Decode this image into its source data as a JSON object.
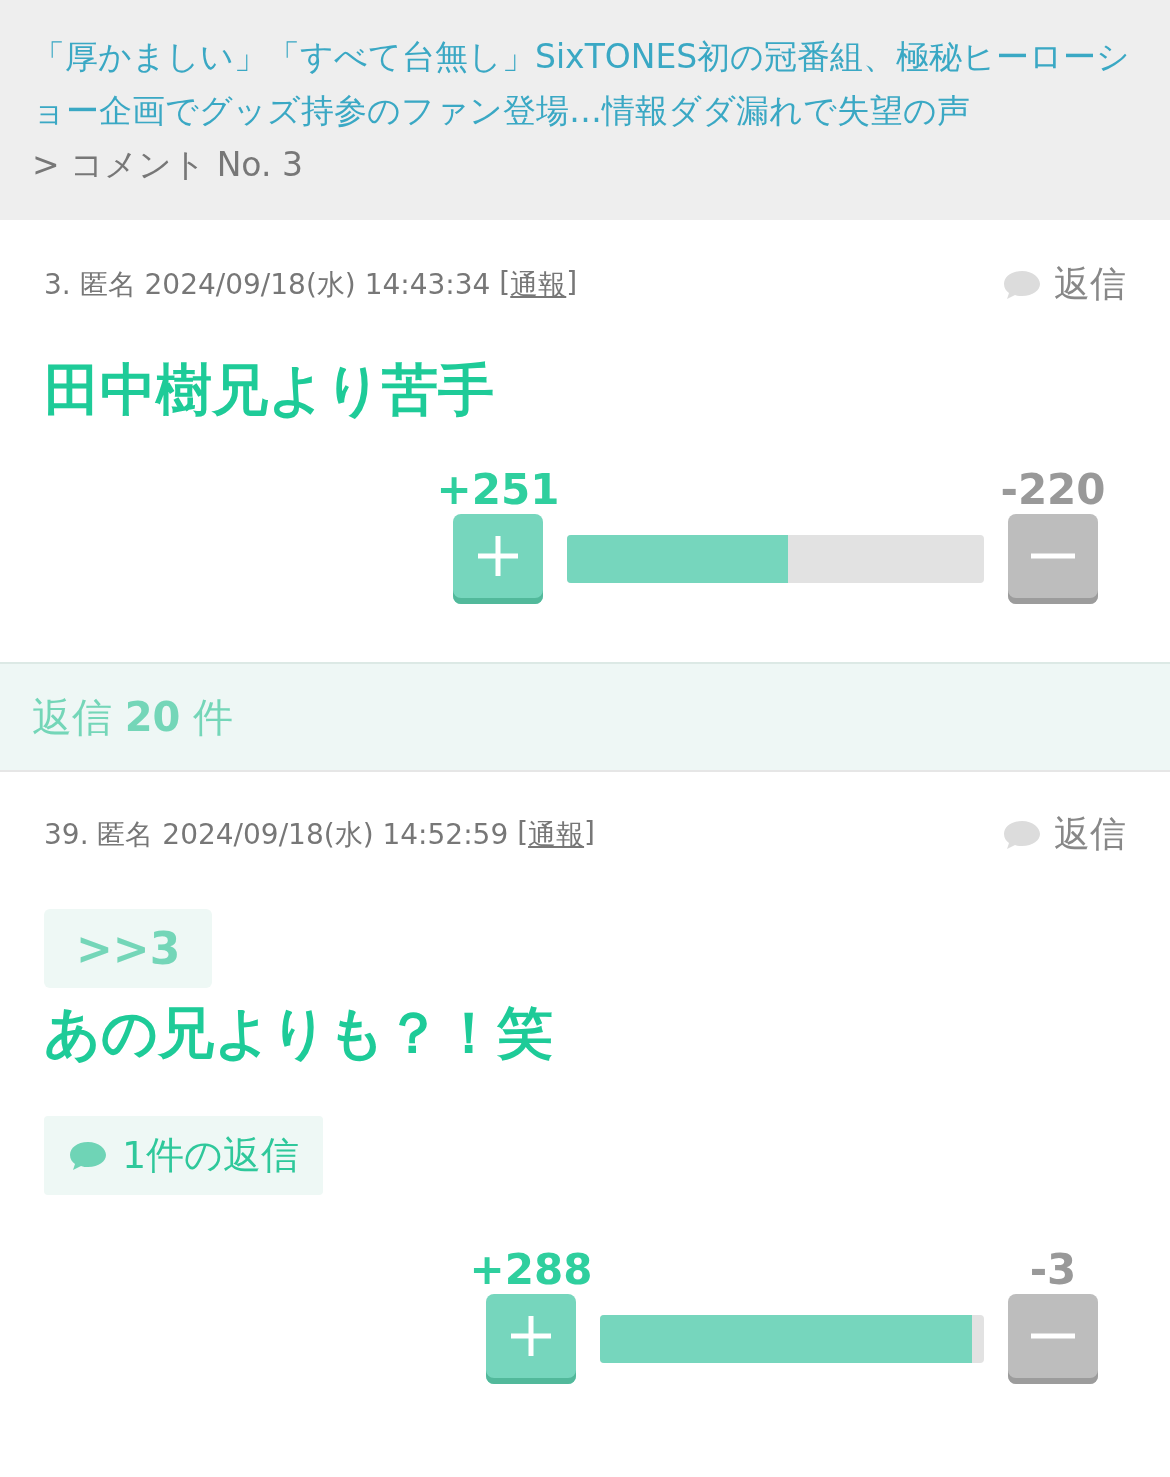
{
  "header": {
    "title": "「厚かましい」「すべて台無し」SixTONES初の冠番組、極秘ヒーローショー企画でグッズ持参のファン登場…情報ダダ漏れで失望の声",
    "breadcrumb": "> コメント No. 3"
  },
  "comment": {
    "meta": "3. 匿名 2024/09/18(水) 14:43:34",
    "report_open": "[",
    "report": "通報",
    "report_close": "]",
    "reply": "返信",
    "body": "田中樹兄より苦手",
    "plus": "+251",
    "minus": "-220",
    "level": 0.53
  },
  "replies_bar": "返信 **20** 件",
  "replies": [
    {
      "meta": "39. 匿名 2024/09/18(水) 14:52:59",
      "report_open": "[",
      "report": "通報",
      "report_close": "]",
      "reply": "返信",
      "anchor": ">>3",
      "body": "あの兄よりも？！笑",
      "reply_count": "1件の返信",
      "plus": "+288",
      "minus": "-3",
      "level": 0.97
    }
  ]
}
